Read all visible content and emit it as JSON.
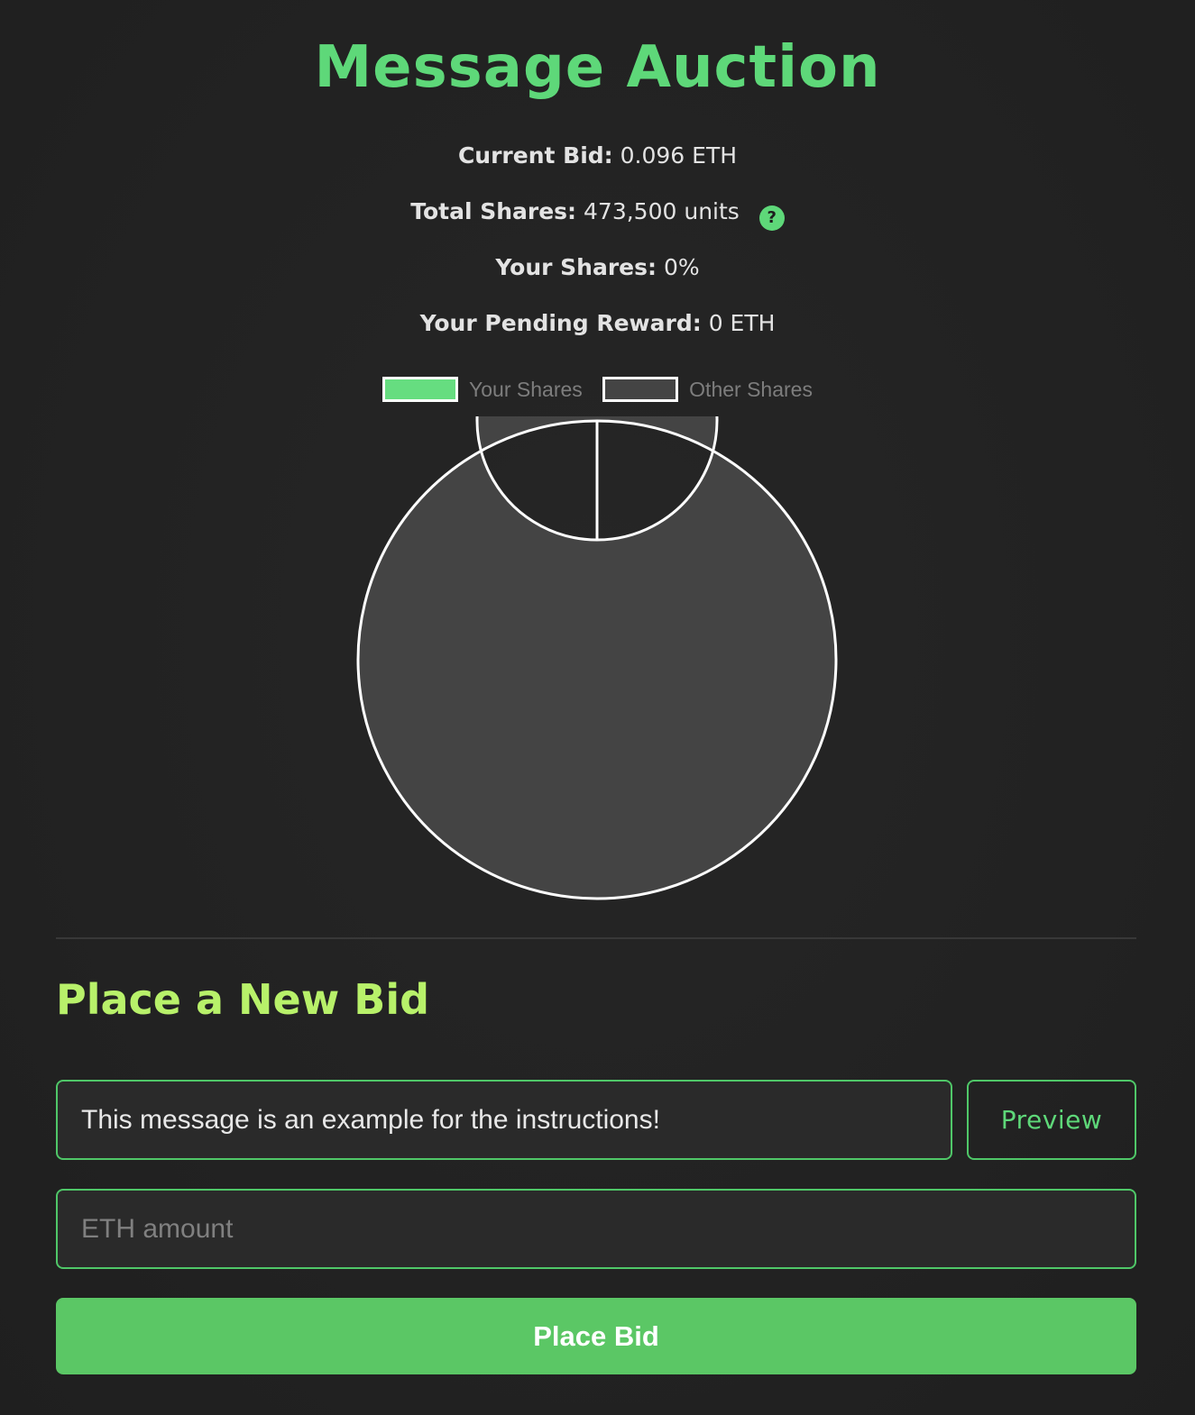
{
  "header": {
    "title": "Message Auction"
  },
  "stats": {
    "current_bid_label": "Current Bid:",
    "current_bid_value": "0.096 ETH",
    "total_shares_label": "Total Shares:",
    "total_shares_value": "473,500 units",
    "help_icon": "question-circle-icon",
    "help_glyph": "?",
    "your_shares_label": "Your Shares:",
    "your_shares_value": "0%",
    "pending_reward_label": "Your Pending Reward:",
    "pending_reward_value": "0 ETH"
  },
  "chart_data": {
    "type": "pie",
    "variant": "doughnut",
    "legend_position": "top",
    "series": [
      {
        "name": "Your Shares",
        "value": 0,
        "color": "#66dd80"
      },
      {
        "name": "Other Shares",
        "value": 473500,
        "color": "#444444"
      }
    ],
    "border_color": "#ffffff"
  },
  "bid_form": {
    "heading": "Place a New Bid",
    "message_value": "This message is an example for the instructions!",
    "preview_label": "Preview",
    "amount_value": "",
    "amount_placeholder": "ETH amount",
    "submit_label": "Place Bid"
  },
  "colors": {
    "accent": "#5ed879",
    "subheading": "#b8f16a",
    "background": "#222222",
    "button": "#5bc765"
  }
}
